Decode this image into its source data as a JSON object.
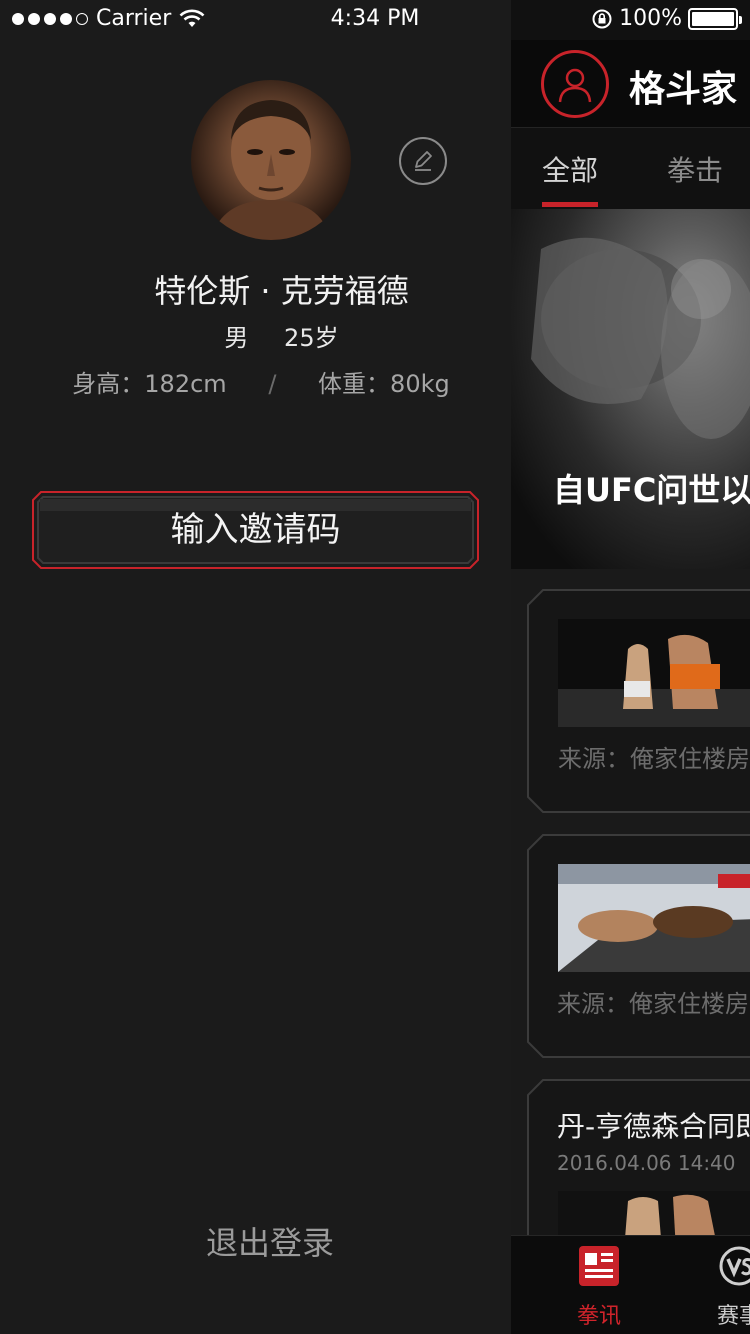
{
  "status_bar": {
    "carrier": "Carrier",
    "time": "4:34 PM",
    "battery": "100%",
    "battery_level": 1.0
  },
  "profile": {
    "name": "特伦斯 · 克劳福德",
    "gender": "男",
    "age": "25岁",
    "height": "身高：182cm",
    "weight": "体重：80kg",
    "separator": "/"
  },
  "actions": {
    "invite_label": "输入邀请码",
    "logout_label": "退出登录"
  },
  "main": {
    "app_title": "格斗家",
    "tabs": [
      {
        "label": "全部",
        "active": true
      },
      {
        "label": "拳击",
        "active": false
      }
    ],
    "hero_title": "自UFC问世以",
    "news": [
      {
        "source": "来源：俺家住楼房"
      },
      {
        "source": "来源：俺家住楼房"
      },
      {
        "title": "丹-亨德森合同即",
        "date": "2016.04.06   14:40"
      }
    ],
    "bottom_tabs": [
      {
        "label": "拳讯",
        "icon": "news-icon",
        "active": true
      },
      {
        "label": "赛事",
        "icon": "vs-icon",
        "active": false
      }
    ]
  },
  "colors": {
    "accent_red": "#c8232a",
    "drawer_bg": "#1b1b1b",
    "text_muted": "#a6a6a6"
  }
}
